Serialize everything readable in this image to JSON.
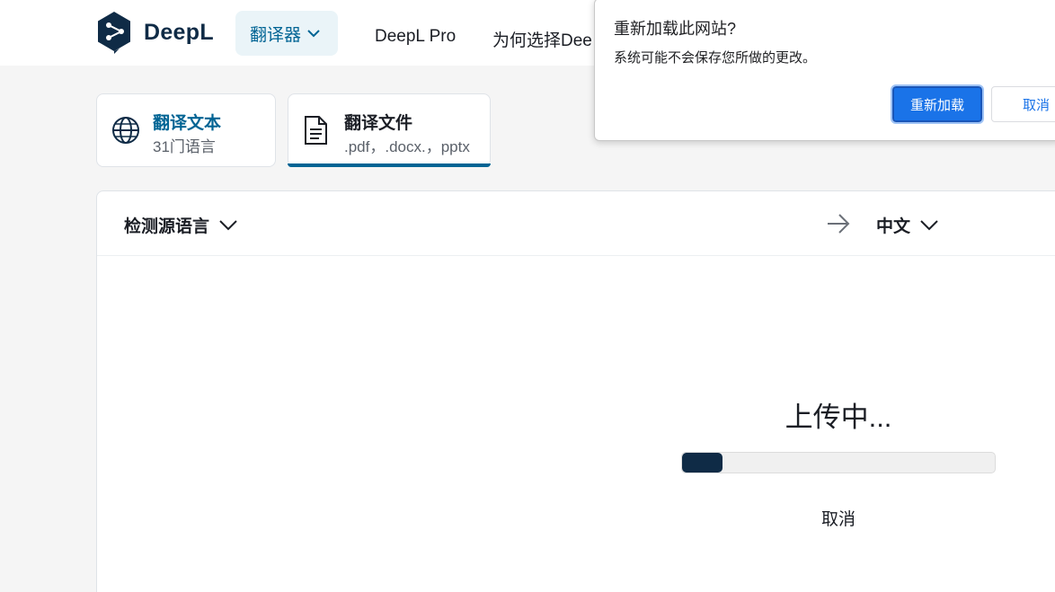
{
  "header": {
    "brand": "DeepL",
    "translator_label": "翻译器",
    "nav_links": [
      "DeepL Pro",
      "为何选择Dee"
    ]
  },
  "modes": [
    {
      "title": "翻译文本",
      "subtitle": "31门语言",
      "icon": "globe-icon",
      "title_color": "#006494"
    },
    {
      "title": "翻译文件",
      "subtitle": ".pdf，.docx.，pptx",
      "icon": "document-icon",
      "active": true
    }
  ],
  "languages": {
    "source": "检测源语言",
    "target": "中文"
  },
  "upload": {
    "status": "上传中...",
    "progress_fraction": 0.13,
    "cancel_label": "取消"
  },
  "dialog": {
    "title": "重新加载此网站?",
    "message": "系统可能不会保存您所做的更改。",
    "confirm_label": "重新加载",
    "cancel_label": "取消"
  },
  "colors": {
    "brand_dark": "#0f2b46",
    "accent": "#006494",
    "dialog_button": "#1a73e8"
  }
}
